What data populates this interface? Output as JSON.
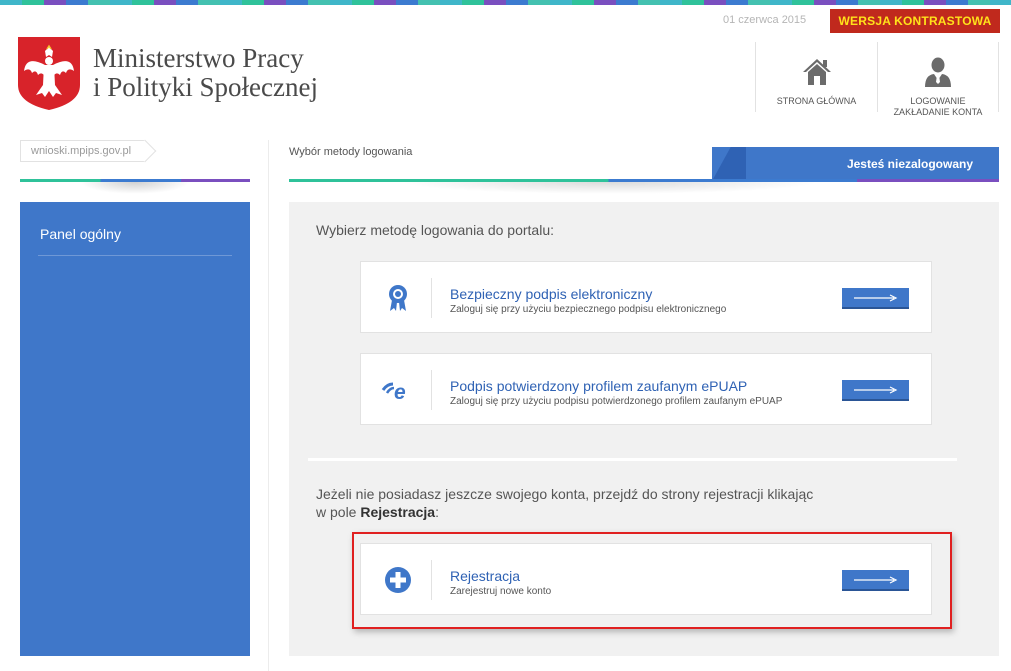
{
  "header": {
    "ministry_line1": "Ministerstwo Pracy",
    "ministry_line2": "i Polityki Społecznej",
    "date": "01 czerwca 2015",
    "contrast_label": "WERSJA KONTRASTOWA",
    "nav": [
      {
        "label_line1": "STRONA GŁÓWNA",
        "label_line2": "",
        "icon": "home-icon"
      },
      {
        "label_line1": "LOGOWANIE",
        "label_line2": "ZAKŁADANIE KONTA",
        "icon": "user-icon"
      }
    ]
  },
  "sidebar": {
    "domain": "wnioski.mpips.gov.pl",
    "items": [
      {
        "label": "Panel ogólny"
      }
    ]
  },
  "main": {
    "breadcrumb": "Wybór metody logowania",
    "status": "Jesteś niezalogowany",
    "intro": "Wybierz metodę logowania do portalu:",
    "options": [
      {
        "title": "Bezpieczny podpis elektroniczny",
        "subtitle": "Zaloguj się przy użyciu bezpiecznego podpisu elektronicznego",
        "icon": "certificate-badge-icon"
      },
      {
        "title": "Podpis potwierdzony profilem zaufanym ePUAP",
        "subtitle": "Zaloguj się przy użyciu podpisu potwierdzonego profilem zaufanym ePUAP",
        "icon": "epuap-icon"
      }
    ],
    "register_text_part1": "Jeżeli nie posiadasz jeszcze swojego konta, przejdź do strony rejestracji klikając",
    "register_text_part2": "w pole ",
    "register_text_bold": "Rejestracja",
    "register_text_end": ":",
    "register": {
      "title": "Rejestracja",
      "subtitle": "Zarejestruj nowe konto",
      "icon": "plus-circle-icon"
    }
  },
  "colors": {
    "accent": "#3f77c9",
    "contrast_bg": "#c0291d",
    "contrast_text": "#ffe21a",
    "highlight": "#e02020"
  }
}
